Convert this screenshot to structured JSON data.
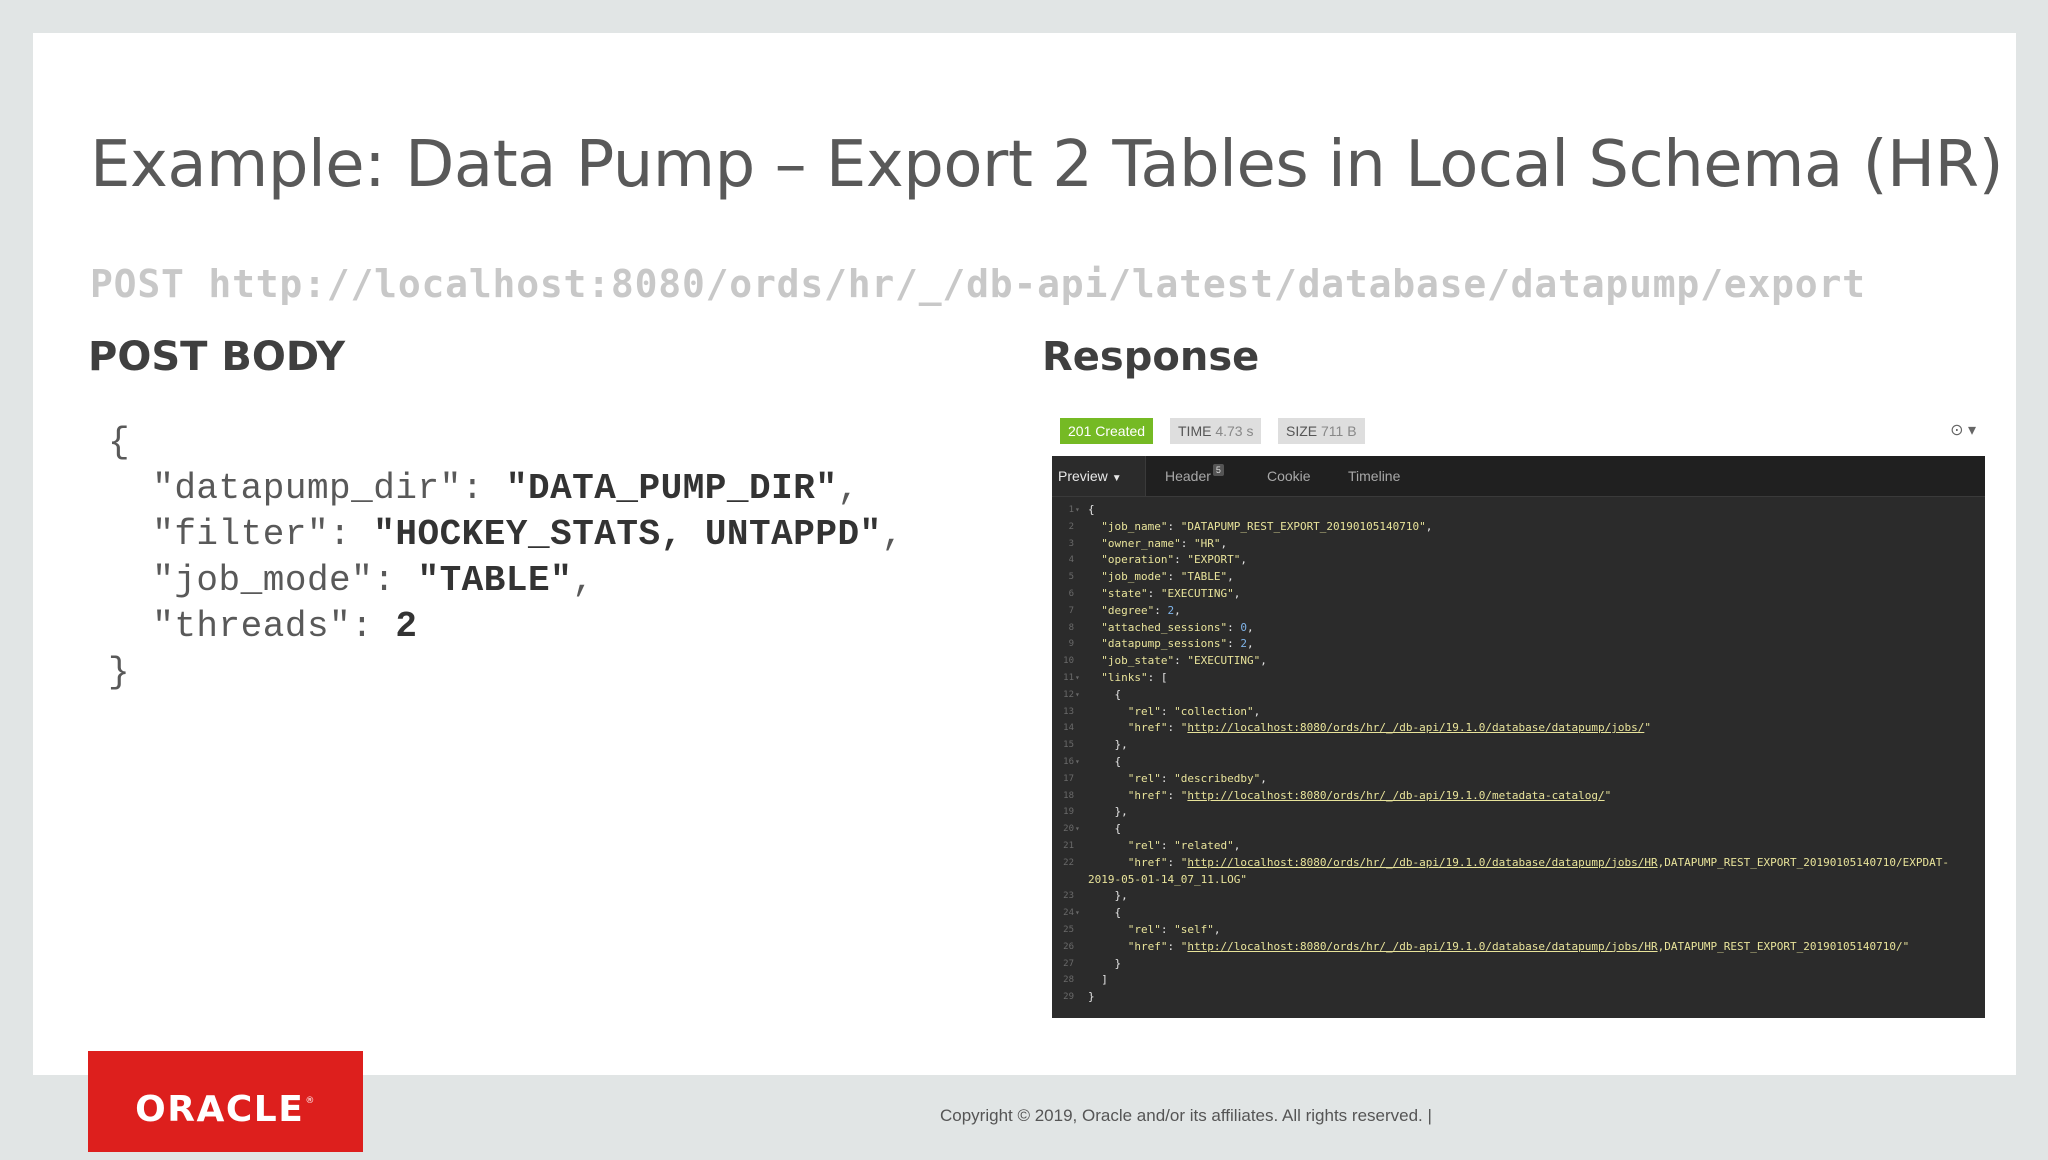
{
  "slide": {
    "title": "Example: Data Pump – Export 2 Tables in Local Schema (HR)",
    "request_line": "POST http://localhost:8080/ords/hr/_/db-api/latest/database/datapump/export"
  },
  "post_body": {
    "heading": "POST BODY",
    "open_brace": "{",
    "close_brace": "}",
    "fields": [
      {
        "key": "\"datapump_dir\": ",
        "value": "\"DATA_PUMP_DIR\"",
        "trail": ","
      },
      {
        "key": "\"filter\": ",
        "value": "\"HOCKEY_STATS, UNTAPPD\"",
        "trail": ","
      },
      {
        "key": "\"job_mode\": ",
        "value": "\"TABLE\"",
        "trail": ","
      },
      {
        "key": "\"threads\": ",
        "value": "2",
        "trail": ""
      }
    ]
  },
  "response": {
    "heading": "Response",
    "status_label": "201 Created",
    "time_label": "TIME",
    "time_value": "4.73 s",
    "size_label": "SIZE",
    "size_value": "711 B",
    "settings_icon": "clock-icon",
    "tabs": {
      "preview": "Preview",
      "header": "Header",
      "header_count": "5",
      "cookie": "Cookie",
      "timeline": "Timeline"
    },
    "colors": {
      "status_green": "#75ba24",
      "panel_bg": "#2b2b2b",
      "string": "#e8e39a",
      "number": "#7fb3e8"
    },
    "json_lines": [
      {
        "n": "1",
        "fold": true,
        "parts": [
          [
            "p",
            "{"
          ]
        ]
      },
      {
        "n": "2",
        "parts": [
          [
            "p",
            "  "
          ],
          [
            "k",
            "\"job_name\""
          ],
          [
            "p",
            ": "
          ],
          [
            "s",
            "\"DATAPUMP_REST_EXPORT_20190105140710\""
          ],
          [
            "p",
            ","
          ]
        ]
      },
      {
        "n": "3",
        "parts": [
          [
            "p",
            "  "
          ],
          [
            "k",
            "\"owner_name\""
          ],
          [
            "p",
            ": "
          ],
          [
            "s",
            "\"HR\""
          ],
          [
            "p",
            ","
          ]
        ]
      },
      {
        "n": "4",
        "parts": [
          [
            "p",
            "  "
          ],
          [
            "k",
            "\"operation\""
          ],
          [
            "p",
            ": "
          ],
          [
            "s",
            "\"EXPORT\""
          ],
          [
            "p",
            ","
          ]
        ]
      },
      {
        "n": "5",
        "parts": [
          [
            "p",
            "  "
          ],
          [
            "k",
            "\"job_mode\""
          ],
          [
            "p",
            ": "
          ],
          [
            "s",
            "\"TABLE\""
          ],
          [
            "p",
            ","
          ]
        ]
      },
      {
        "n": "6",
        "parts": [
          [
            "p",
            "  "
          ],
          [
            "k",
            "\"state\""
          ],
          [
            "p",
            ": "
          ],
          [
            "s",
            "\"EXECUTING\""
          ],
          [
            "p",
            ","
          ]
        ]
      },
      {
        "n": "7",
        "parts": [
          [
            "p",
            "  "
          ],
          [
            "k",
            "\"degree\""
          ],
          [
            "p",
            ": "
          ],
          [
            "n",
            "2"
          ],
          [
            "p",
            ","
          ]
        ]
      },
      {
        "n": "8",
        "parts": [
          [
            "p",
            "  "
          ],
          [
            "k",
            "\"attached_sessions\""
          ],
          [
            "p",
            ": "
          ],
          [
            "n",
            "0"
          ],
          [
            "p",
            ","
          ]
        ]
      },
      {
        "n": "9",
        "parts": [
          [
            "p",
            "  "
          ],
          [
            "k",
            "\"datapump_sessions\""
          ],
          [
            "p",
            ": "
          ],
          [
            "n",
            "2"
          ],
          [
            "p",
            ","
          ]
        ]
      },
      {
        "n": "10",
        "parts": [
          [
            "p",
            "  "
          ],
          [
            "k",
            "\"job_state\""
          ],
          [
            "p",
            ": "
          ],
          [
            "s",
            "\"EXECUTING\""
          ],
          [
            "p",
            ","
          ]
        ]
      },
      {
        "n": "11",
        "fold": true,
        "parts": [
          [
            "p",
            "  "
          ],
          [
            "k",
            "\"links\""
          ],
          [
            "p",
            ": ["
          ]
        ]
      },
      {
        "n": "12",
        "fold": true,
        "parts": [
          [
            "p",
            "    {"
          ]
        ]
      },
      {
        "n": "13",
        "parts": [
          [
            "p",
            "      "
          ],
          [
            "k",
            "\"rel\""
          ],
          [
            "p",
            ": "
          ],
          [
            "s",
            "\"collection\""
          ],
          [
            "p",
            ","
          ]
        ]
      },
      {
        "n": "14",
        "parts": [
          [
            "p",
            "      "
          ],
          [
            "k",
            "\"href\""
          ],
          [
            "p",
            ": "
          ],
          [
            "s",
            "\""
          ],
          [
            "lnk",
            "http://localhost:8080/ords/hr/_/db-api/19.1.0/database/datapump/jobs/"
          ],
          [
            "s",
            "\""
          ]
        ]
      },
      {
        "n": "15",
        "parts": [
          [
            "p",
            "    },"
          ]
        ]
      },
      {
        "n": "16",
        "fold": true,
        "parts": [
          [
            "p",
            "    {"
          ]
        ]
      },
      {
        "n": "17",
        "parts": [
          [
            "p",
            "      "
          ],
          [
            "k",
            "\"rel\""
          ],
          [
            "p",
            ": "
          ],
          [
            "s",
            "\"describedby\""
          ],
          [
            "p",
            ","
          ]
        ]
      },
      {
        "n": "18",
        "parts": [
          [
            "p",
            "      "
          ],
          [
            "k",
            "\"href\""
          ],
          [
            "p",
            ": "
          ],
          [
            "s",
            "\""
          ],
          [
            "lnk",
            "http://localhost:8080/ords/hr/_/db-api/19.1.0/metadata-catalog/"
          ],
          [
            "s",
            "\""
          ]
        ]
      },
      {
        "n": "19",
        "parts": [
          [
            "p",
            "    },"
          ]
        ]
      },
      {
        "n": "20",
        "fold": true,
        "parts": [
          [
            "p",
            "    {"
          ]
        ]
      },
      {
        "n": "21",
        "parts": [
          [
            "p",
            "      "
          ],
          [
            "k",
            "\"rel\""
          ],
          [
            "p",
            ": "
          ],
          [
            "s",
            "\"related\""
          ],
          [
            "p",
            ","
          ]
        ]
      },
      {
        "n": "22",
        "parts": [
          [
            "p",
            "      "
          ],
          [
            "k",
            "\"href\""
          ],
          [
            "p",
            ": "
          ],
          [
            "s",
            "\""
          ],
          [
            "lnk",
            "http://localhost:8080/ords/hr/_/db-api/19.1.0/database/datapump/jobs/HR"
          ],
          [
            "s",
            ",DATAPUMP_REST_EXPORT_20190105140710/EXPDAT-"
          ]
        ]
      },
      {
        "n": "",
        "parts": [
          [
            "s",
            "2019-05-01-14_07_11.LOG\""
          ]
        ]
      },
      {
        "n": "23",
        "parts": [
          [
            "p",
            "    },"
          ]
        ]
      },
      {
        "n": "24",
        "fold": true,
        "parts": [
          [
            "p",
            "    {"
          ]
        ]
      },
      {
        "n": "25",
        "parts": [
          [
            "p",
            "      "
          ],
          [
            "k",
            "\"rel\""
          ],
          [
            "p",
            ": "
          ],
          [
            "s",
            "\"self\""
          ],
          [
            "p",
            ","
          ]
        ]
      },
      {
        "n": "26",
        "parts": [
          [
            "p",
            "      "
          ],
          [
            "k",
            "\"href\""
          ],
          [
            "p",
            ": "
          ],
          [
            "s",
            "\""
          ],
          [
            "lnk",
            "http://localhost:8080/ords/hr/_/db-api/19.1.0/database/datapump/jobs/HR"
          ],
          [
            "s",
            ",DATAPUMP_REST_EXPORT_20190105140710/\""
          ]
        ]
      },
      {
        "n": "27",
        "parts": [
          [
            "p",
            "    }"
          ]
        ]
      },
      {
        "n": "28",
        "parts": [
          [
            "p",
            "  ]"
          ]
        ]
      },
      {
        "n": "29",
        "parts": [
          [
            "p",
            "}"
          ]
        ]
      }
    ]
  },
  "footer": {
    "logo_text": "ORACLE",
    "logo_mark": "®",
    "copyright": "Copyright © 2019, Oracle and/or its affiliates. All rights reserved.  |"
  }
}
